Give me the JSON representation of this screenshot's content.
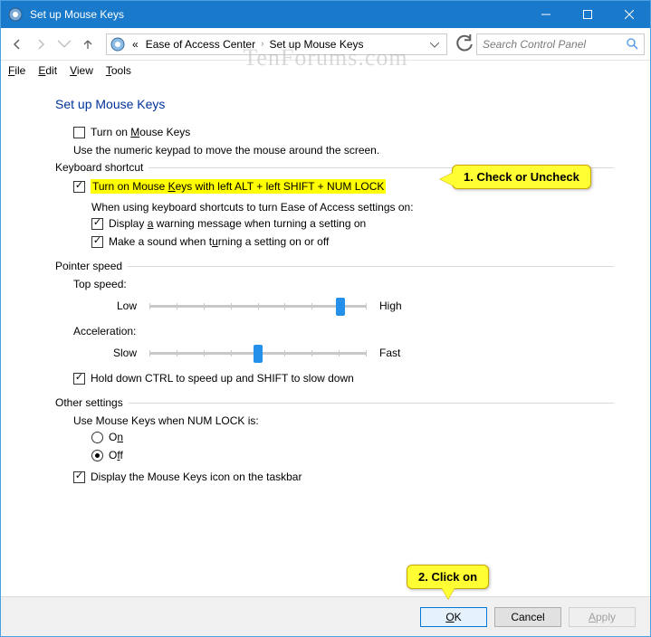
{
  "window": {
    "title": "Set up Mouse Keys"
  },
  "breadcrumb": {
    "prefix": "«",
    "item1": "Ease of Access Center",
    "item2": "Set up Mouse Keys"
  },
  "search": {
    "placeholder": "Search Control Panel"
  },
  "menu": {
    "file": "File",
    "edit": "Edit",
    "view": "View",
    "tools": "Tools"
  },
  "page": {
    "heading": "Set up Mouse Keys"
  },
  "turn_on": {
    "label": "Turn on Mouse Keys",
    "hint": "Use the numeric keypad to move the mouse around the screen."
  },
  "keyboard_shortcut": {
    "legend": "Keyboard shortcut",
    "toggle": "Turn on Mouse Keys with left ALT + left SHIFT + NUM LOCK",
    "when": "When using keyboard shortcuts to turn Ease of Access settings on:",
    "warn": "Display a warning message when turning a setting on",
    "sound": "Make a sound when turning a setting on or off"
  },
  "pointer_speed": {
    "legend": "Pointer speed",
    "top_speed": "Top speed:",
    "low": "Low",
    "high": "High",
    "accel": "Acceleration:",
    "slow": "Slow",
    "fast": "Fast",
    "ctrl_shift": "Hold down CTRL to speed up and SHIFT to slow down"
  },
  "other": {
    "legend": "Other settings",
    "use_when": "Use Mouse Keys when NUM LOCK is:",
    "on": "On",
    "off": "Off",
    "taskbar": "Display the Mouse Keys icon on the taskbar"
  },
  "buttons": {
    "ok": "OK",
    "cancel": "Cancel",
    "apply": "Apply"
  },
  "callouts": {
    "c1": "1. Check or Uncheck",
    "c2": "2. Click on"
  },
  "watermark": "TenForums.com"
}
